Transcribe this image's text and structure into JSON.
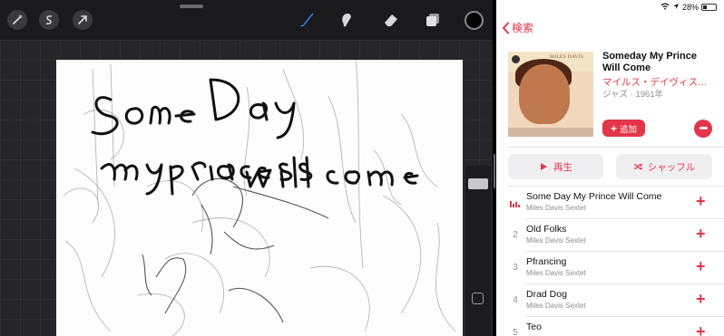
{
  "status_bar": {
    "battery": "28%"
  },
  "procreate": {
    "toolbar": {
      "left_icons": [
        "wand-icon",
        "s-curve-icon",
        "arrow-cursor-icon"
      ],
      "tools": [
        "brush-icon",
        "smudge-icon",
        "eraser-icon",
        "layers-icon"
      ],
      "active_tool": "brush-icon",
      "current_color": "#050505"
    },
    "canvas": {
      "sketch_text": [
        "Some Day",
        "My princess",
        "Will come"
      ]
    }
  },
  "music": {
    "back_label": "検索",
    "album": {
      "title": "Someday My Prince Will Come",
      "artist": "マイルス・デイヴィス・…",
      "meta": "ジャズ · 1961年",
      "artwork_text": "MILES DAVIS",
      "add_label": "追加",
      "more_label": "•••"
    },
    "play_label": "再生",
    "shuffle_label": "シャッフル",
    "tracks": [
      {
        "num": "",
        "title": "Some Day My Prince Will Come",
        "artist": "Miles Davis Sextet",
        "playing": true
      },
      {
        "num": "2",
        "title": "Old Folks",
        "artist": "Miles Davis Sextet",
        "playing": false
      },
      {
        "num": "3",
        "title": "Pfrancing",
        "artist": "Miles Davis Sextet",
        "playing": false
      },
      {
        "num": "4",
        "title": "Drad Dog",
        "artist": "Miles Davis Sextet",
        "playing": false
      },
      {
        "num": "5",
        "title": "Teo",
        "artist": "",
        "playing": false
      }
    ],
    "accent_color": "#e3364a"
  }
}
